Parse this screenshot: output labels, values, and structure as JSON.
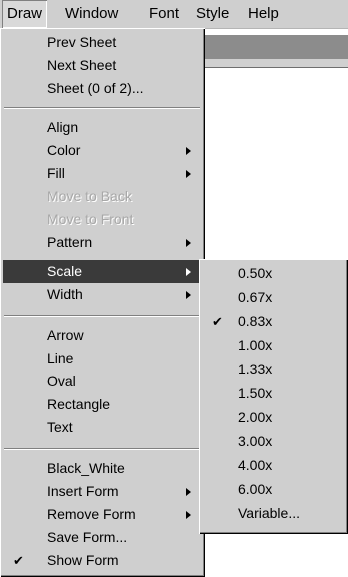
{
  "menubar": {
    "items": [
      {
        "label": "Draw"
      },
      {
        "label": "Window"
      },
      {
        "label": "Font"
      },
      {
        "label": "Style"
      },
      {
        "label": "Help"
      }
    ]
  },
  "draw_menu": {
    "items": [
      "Prev Sheet",
      "Next Sheet",
      "Sheet (0 of 2)...",
      "Align",
      "Color",
      "Fill",
      "Move to Back",
      "Move to Front",
      "Pattern",
      "Scale",
      "Width",
      "Arrow",
      "Line",
      "Oval",
      "Rectangle",
      "Text",
      "Black_White",
      "Insert Form",
      "Remove Form",
      "Save Form...",
      "Show Form"
    ],
    "highlighted": "Scale",
    "disabled": [
      "Move to Back",
      "Move to Front"
    ],
    "checked": [
      "Show Form"
    ]
  },
  "scale_submenu": {
    "items": [
      "0.50x",
      "0.67x",
      "0.83x",
      "1.00x",
      "1.33x",
      "1.50x",
      "2.00x",
      "3.00x",
      "4.00x",
      "6.00x",
      "Variable..."
    ],
    "checked": "0.83x"
  },
  "icons": {
    "checkmark": "check-icon",
    "submenu_arrow": "arrow-right-icon"
  },
  "colors": {
    "menu_bg": "#cfcfcf",
    "highlight_bg": "#3a3a3a",
    "disabled_text": "#a8a8a8"
  }
}
